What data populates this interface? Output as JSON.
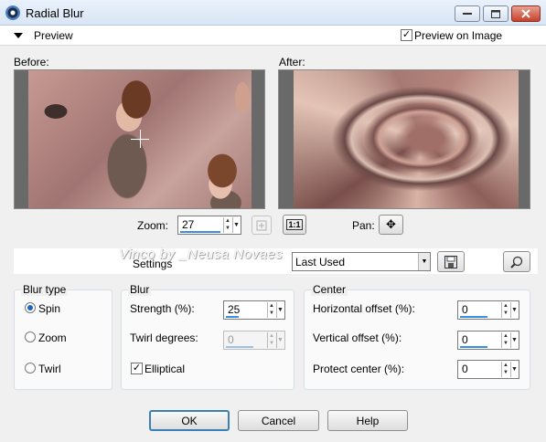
{
  "window": {
    "title": "Radial Blur",
    "buttons": {
      "minimize": "▭",
      "maximize": "▢",
      "close": "✕"
    }
  },
  "preview": {
    "label": "Preview",
    "preview_on_image_label": "Preview on Image",
    "preview_on_image_checked": true,
    "before_label": "Before:",
    "after_label": "After:",
    "zoom_label": "Zoom:",
    "zoom_value": "27",
    "actual_size_label": "1:1",
    "pan_label": "Pan:",
    "pan_icon": "✥"
  },
  "settings": {
    "label": "Settings",
    "watermark": "Vinco by _Neusa Novaes",
    "preset_value": "Last Used"
  },
  "blur_type": {
    "title": "Blur type",
    "options": [
      "Spin",
      "Zoom",
      "Twirl"
    ],
    "selected": "Spin"
  },
  "blur": {
    "title": "Blur",
    "strength_label": "Strength (%):",
    "strength_value": "25",
    "twirl_label": "Twirl degrees:",
    "twirl_value": "0",
    "elliptical_label": "Elliptical",
    "elliptical_checked": true
  },
  "center": {
    "title": "Center",
    "horizontal_label": "Horizontal offset (%):",
    "horizontal_value": "0",
    "vertical_label": "Vertical offset (%):",
    "vertical_value": "0",
    "protect_label": "Protect center (%):",
    "protect_value": "0"
  },
  "actions": {
    "ok": "OK",
    "cancel": "Cancel",
    "help": "Help"
  },
  "colors": {
    "accent": "#3a8ee6",
    "default_button_border": "#3c7fb1",
    "close_button": "#c6412b"
  },
  "icons": {
    "app": "radial-blur-app-icon",
    "checkmark": "✓",
    "spin_up": "▲",
    "spin_down": "▼",
    "dropdown": "▼",
    "save": "save-preset-icon",
    "reset": "reset-randomize-icon",
    "proof": "proof-preview-icon"
  }
}
